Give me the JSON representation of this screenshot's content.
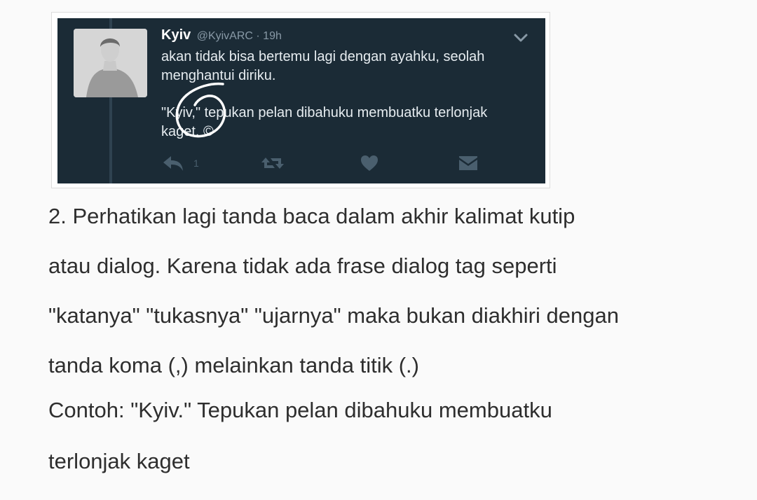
{
  "tweet": {
    "author_name": "Kyiv",
    "author_handle": "@KyivARC",
    "time": "· 19h",
    "lines": [
      "akan tidak bisa bertemu lagi dengan ayahku, seolah",
      "menghantui diriku.",
      "\"Kyiv,\" tepukan pelan dibahuku membuatku terlonjak",
      "kaget. ©"
    ],
    "reply_count": "1",
    "icons": {
      "caret": "chevron-down-icon",
      "reply": "reply-icon",
      "retweet": "retweet-icon",
      "like": "heart-icon",
      "dm": "envelope-icon"
    },
    "colors": {
      "background": "#1b2b36",
      "text": "#e6ecf0",
      "muted": "#8899a6",
      "icon": "#4a5f6e"
    }
  },
  "article": {
    "lines": [
      "2. Perhatikan lagi tanda baca dalam akhir kalimat kutip",
      "atau dialog. Karena tidak ada frase dialog tag seperti",
      "\"katanya\" \"tukasnya\" \"ujarnya\" maka bukan diakhiri dengan",
      "tanda koma (,) melainkan tanda titik (.)",
      "Contoh: \"Kyiv.\" Tepukan pelan dibahuku membuatku",
      "terlonjak kaget"
    ]
  }
}
